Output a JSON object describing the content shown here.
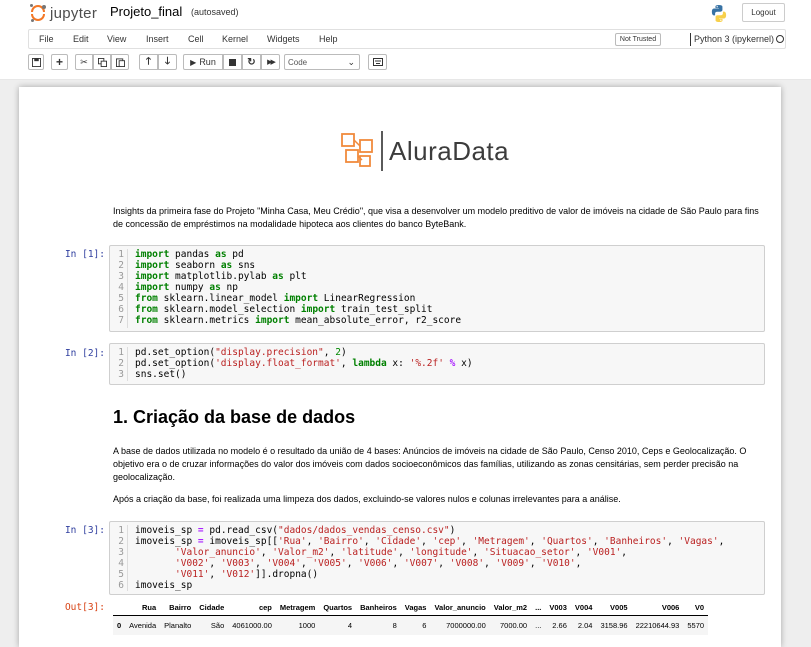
{
  "header": {
    "brand": "jupyter",
    "notebook_name": "Projeto_final",
    "save_status": "(autosaved)",
    "logout_label": "Logout"
  },
  "menubar": {
    "items": [
      "File",
      "Edit",
      "View",
      "Insert",
      "Cell",
      "Kernel",
      "Widgets",
      "Help"
    ],
    "trust_label": "Not Trusted",
    "kernel_name": "Python 3 (ipykernel)"
  },
  "toolbar": {
    "run_label": "Run",
    "cell_type": "Code"
  },
  "notebook": {
    "logo_text": "AluraData",
    "intro": "Insights da primeira fase do Projeto \"Minha Casa, Meu Crédio\", que visa a desenvolver um modelo preditivo de valor de imóveis na cidade de São Paulo para fins de concessão de empréstimos na modalidade hipoteca aos clientes do banco ByteBank.",
    "cell1_prompt": "In [1]:",
    "cell2_prompt": "In [2]:",
    "heading1": "1. Criação da base de dados",
    "para1": "A base de dados utilizada no modelo é o resultado da união de 4 bases: Anúncios de imóveis na cidade de São Paulo, Censo 2010, Ceps e Geolocalização. O objetivo era o de cruzar informações do valor dos imóveis com dados socioeconômicos das famílias, utilizando as zonas censitárias, sem perder precisão na geolocalização.",
    "para2": "Após a criação da base, foi realizada uma limpeza dos dados, excluindo-se valores nulos e colunas irrelevantes para a análise.",
    "cell3_prompt": "In [3]:",
    "out3_prompt": "Out[3]:",
    "line_numbers": {
      "cell1": [
        "1",
        "2",
        "3",
        "4",
        "5",
        "6",
        "7"
      ],
      "cell2": [
        "1",
        "2",
        "3"
      ],
      "cell3": [
        "1",
        "2",
        "3",
        "4",
        "5",
        "6"
      ]
    }
  },
  "dataframe": {
    "columns": [
      "",
      "Rua",
      "Bairro",
      "Cidade",
      "cep",
      "Metragem",
      "Quartos",
      "Banheiros",
      "Vagas",
      "Valor_anuncio",
      "Valor_m2",
      "...",
      "V003",
      "V004",
      "V005",
      "V006",
      "V0"
    ],
    "rows": [
      [
        "0",
        "Avenida",
        "Planalto",
        "São",
        "4061000.00",
        "1000",
        "4",
        "8",
        "6",
        "7000000.00",
        "7000.00",
        "...",
        "2.66",
        "2.04",
        "3158.96",
        "22210644.93",
        "5570"
      ]
    ]
  }
}
